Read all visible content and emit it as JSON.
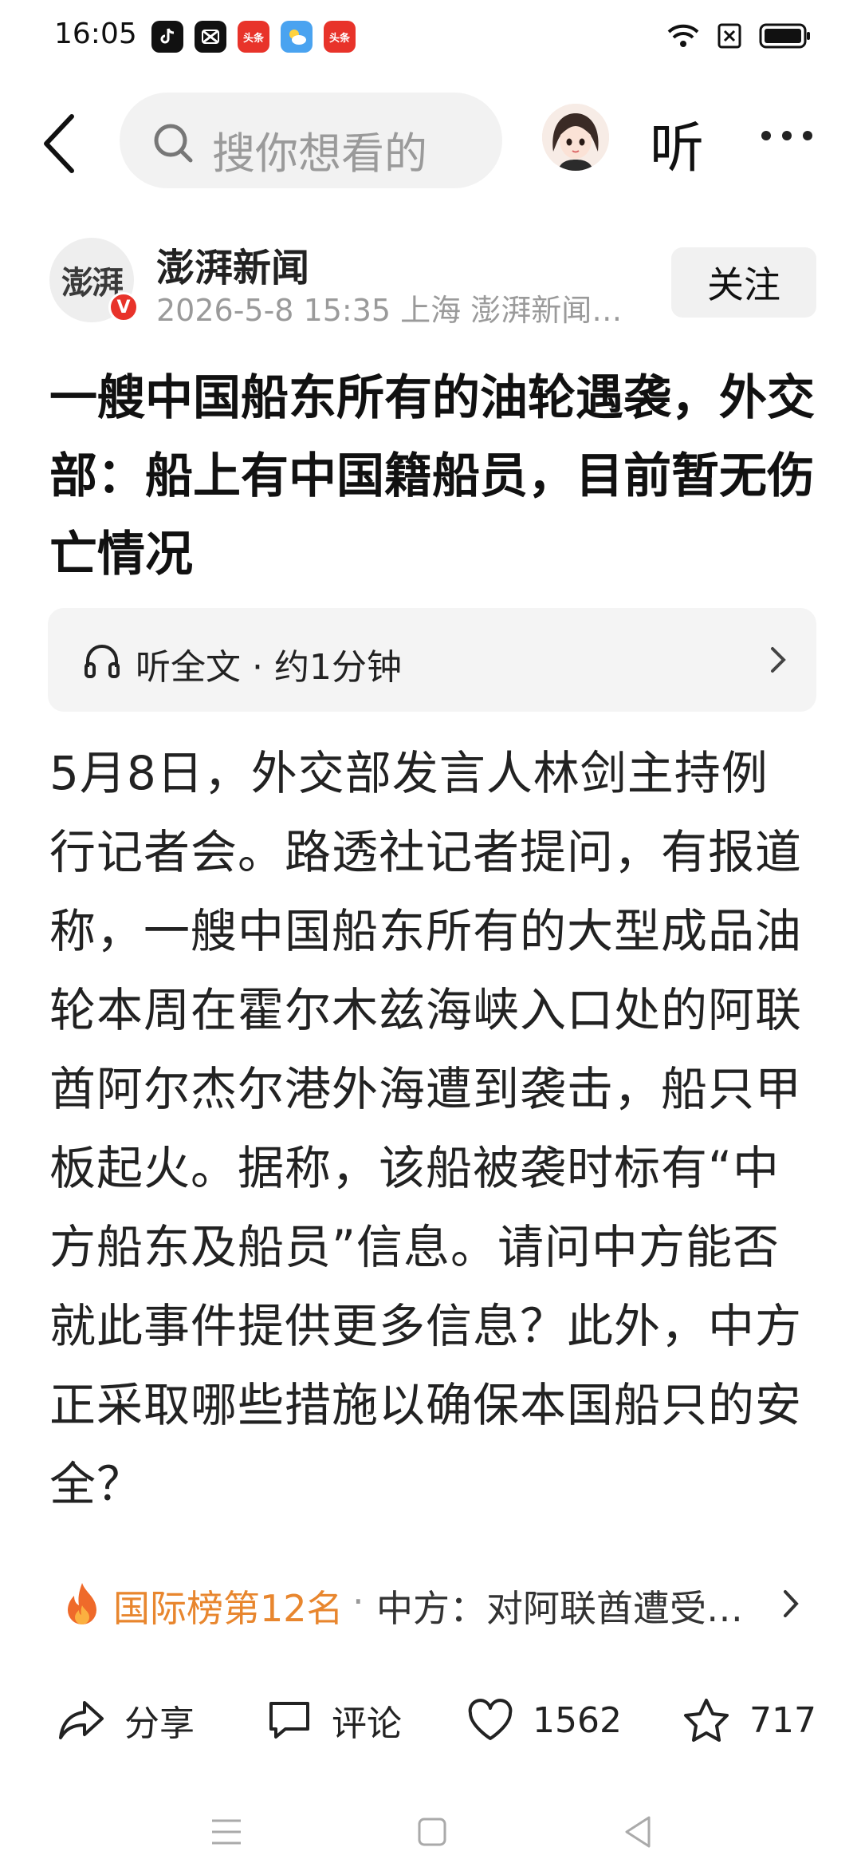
{
  "status_bar": {
    "time": "16:05",
    "app_badges": [
      "头条",
      "头条"
    ]
  },
  "topbar": {
    "search_placeholder": "搜你想看的",
    "listen_label": "听"
  },
  "author": {
    "logo_text": "澎湃",
    "verified_mark": "V",
    "name": "澎湃新闻",
    "meta": "2026-5-8  15:35  上海  澎湃新闻…",
    "follow_label": "关注"
  },
  "article": {
    "headline": "一艘中国船东所有的油轮遇袭，外交部：船上有中国籍船员，目前暂无伤亡情况",
    "listen_card": "听全文 · 约1分钟",
    "body": "5月8日，外交部发言人林剑主持例行记者会。路透社记者提问，有报道称，一艘中国船东所有的大型成品油轮本周在霍尔木兹海峡入口处的阿联酋阿尔杰尔港外海遭到袭击，船只甲板起火。据称，该船被袭时标有“中方船东及船员”信息。请问中方能否就此事件提供更多信息？此外，中方正采取哪些措施以确保本国船只的安全？"
  },
  "hot": {
    "rank": "国际榜第12名",
    "separator": "·",
    "title": "中方：对阿联酋遭受…"
  },
  "actions": {
    "share": "分享",
    "comment": "评论",
    "likes": "1562",
    "favorites": "717"
  },
  "colors": {
    "accent_orange": "#e8862e",
    "verify_red": "#e8332a"
  }
}
